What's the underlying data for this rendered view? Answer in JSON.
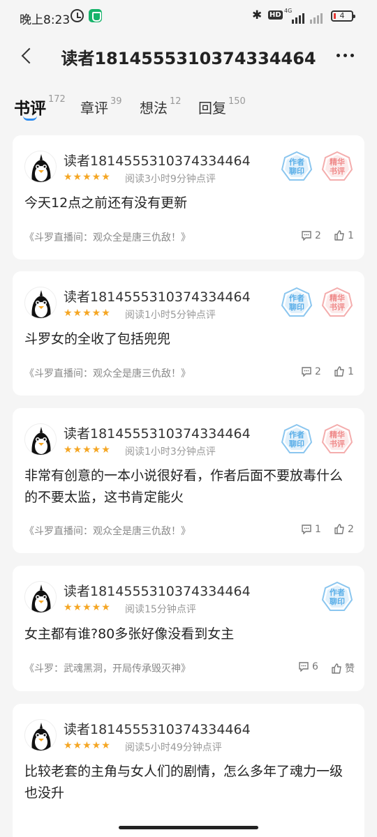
{
  "status_bar": {
    "time": "晚上8:23",
    "network": "4G",
    "battery": "4",
    "icons": [
      "alarm-icon",
      "security-shield-icon",
      "bluetooth-icon",
      "hd-icon",
      "signal-icon",
      "battery-icon"
    ]
  },
  "header": {
    "title": "读者1814555310374334464",
    "back_icon": "chevron-left-icon",
    "more_icon": "more-dots-icon"
  },
  "tabs": [
    {
      "label": "书评",
      "count": "172",
      "active": true
    },
    {
      "label": "章评",
      "count": "39",
      "active": false
    },
    {
      "label": "想法",
      "count": "12",
      "active": false
    },
    {
      "label": "回复",
      "count": "150",
      "active": false
    }
  ],
  "badges": {
    "author_like": {
      "line1": "作者",
      "line2": "聊印",
      "color": "#5aaee8"
    },
    "featured": {
      "line1": "精华",
      "line2": "书评",
      "color": "#ef8a8a"
    }
  },
  "colors": {
    "accent": "#2d8cf0",
    "star": "#f5a623",
    "background": "#f5f5f5"
  },
  "reviews": [
    {
      "username": "读者1814555310374334464",
      "rating": 5,
      "stars": "★★★★★",
      "read_meta": "阅读3小时9分钟点评",
      "badges": [
        "author_like",
        "featured"
      ],
      "text": "今天12点之前还有没有更新",
      "book": "《斗罗直播间：观众全是唐三仇敌！》",
      "replies": "2",
      "likes": "1"
    },
    {
      "username": "读者1814555310374334464",
      "rating": 5,
      "stars": "★★★★★",
      "read_meta": "阅读1小时5分钟点评",
      "badges": [
        "author_like",
        "featured"
      ],
      "text": "斗罗女的全收了包括兜兜",
      "book": "《斗罗直播间：观众全是唐三仇敌！》",
      "replies": "2",
      "likes": "1"
    },
    {
      "username": "读者1814555310374334464",
      "rating": 5,
      "stars": "★★★★★",
      "read_meta": "阅读1小时3分钟点评",
      "badges": [
        "author_like",
        "featured"
      ],
      "text": "非常有创意的一本小说很好看，作者后面不要放毒什么的不要太监，这书肯定能火",
      "book": "《斗罗直播间：观众全是唐三仇敌！》",
      "replies": "1",
      "likes": "2"
    },
    {
      "username": "读者1814555310374334464",
      "rating": 5,
      "stars": "★★★★★",
      "read_meta": "阅读15分钟点评",
      "badges": [
        "author_like"
      ],
      "text": "女主都有谁?80多张好像没看到女主",
      "book": "《斗罗：武魂黑洞，开局传承毁灭神》",
      "replies": "6",
      "likes": "赞"
    },
    {
      "username": "读者1814555310374334464",
      "rating": 5,
      "stars": "★★★★★",
      "read_meta": "阅读5小时49分钟点评",
      "badges": [],
      "text": "比较老套的主角与女人们的剧情，怎么多年了魂力一级也没升",
      "book": "",
      "replies": "",
      "likes": ""
    }
  ]
}
